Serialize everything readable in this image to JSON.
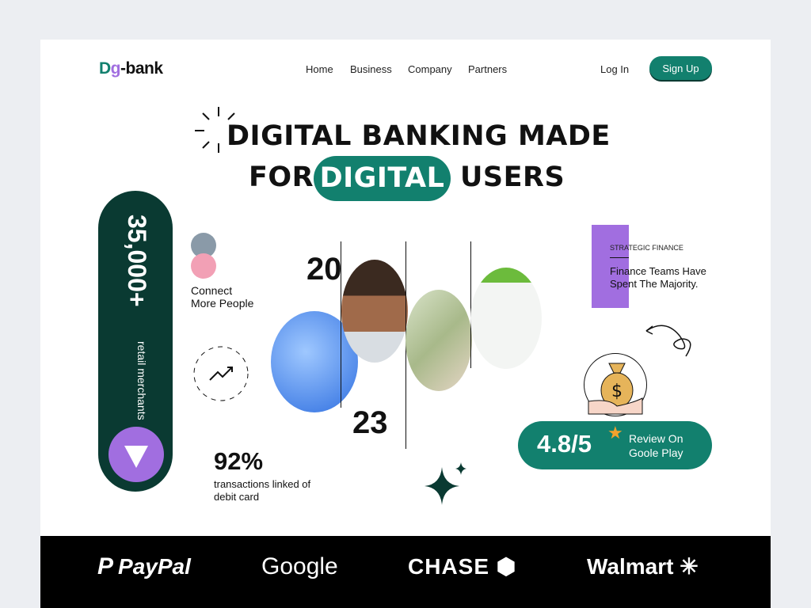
{
  "header": {
    "logo_d": "D",
    "logo_g": "g",
    "logo_rest": "-bank",
    "nav": [
      "Home",
      "Business",
      "Company",
      "Partners"
    ],
    "login": "Log In",
    "signup": "Sign Up"
  },
  "hero": {
    "line1": "DIGITAL BANKING MADE",
    "for": "FOR",
    "highlight": "DIGITAL",
    "users": "USERS"
  },
  "stats": {
    "merchants_value": "35,000+",
    "merchants_label": "retail merchants",
    "connect_line1": "Connect",
    "connect_line2": "More People",
    "year_top": "20",
    "year_bottom": "23",
    "percent": "92%",
    "percent_line1": "transactions linked of",
    "percent_line2": "debit card"
  },
  "strategic": {
    "eyebrow": "STRATEGIC FINANCE",
    "line1": "Finance Teams Have",
    "line2": "Spent The Majority."
  },
  "rating": {
    "value": "4.8/5",
    "line1": "Review On",
    "line2": "Goole Play"
  },
  "partners": [
    "PayPal",
    "Google",
    "CHASE",
    "Walmart"
  ]
}
